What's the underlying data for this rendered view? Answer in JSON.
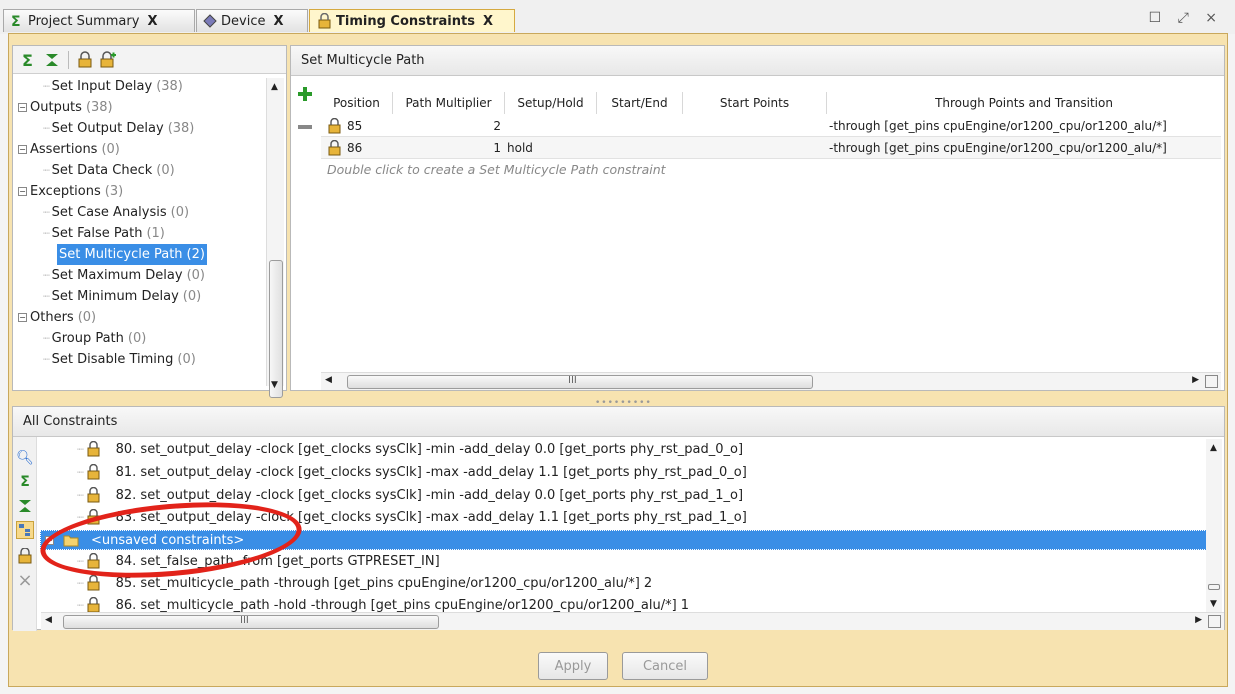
{
  "tabs": [
    {
      "label": "Project Summary",
      "icon": "sigma-icon",
      "close": "X"
    },
    {
      "label": "Device",
      "icon": "device-chip-icon",
      "close": "X"
    },
    {
      "label": "Timing Constraints",
      "icon": "timing-lock-icon",
      "close": "X"
    }
  ],
  "window_controls": "☐ ⤢ ×",
  "tree": {
    "items": [
      {
        "label": "Set Input Delay",
        "count": "(38)"
      },
      {
        "label": "Outputs",
        "count": "(38)"
      },
      {
        "label": "Set Output Delay",
        "count": "(38)"
      },
      {
        "label": "Assertions",
        "count": "(0)"
      },
      {
        "label": "Set Data Check",
        "count": "(0)"
      },
      {
        "label": "Exceptions",
        "count": "(3)"
      },
      {
        "label": "Set Case Analysis",
        "count": "(0)"
      },
      {
        "label": "Set False Path",
        "count": "(1)"
      },
      {
        "label": "Set Multicycle Path",
        "count": "(2)"
      },
      {
        "label": "Set Maximum Delay",
        "count": "(0)"
      },
      {
        "label": "Set Minimum Delay",
        "count": "(0)"
      },
      {
        "label": "Others",
        "count": "(0)"
      },
      {
        "label": "Group Path",
        "count": "(0)"
      },
      {
        "label": "Set Disable Timing",
        "count": "(0)"
      }
    ]
  },
  "multicycle": {
    "title": "Set Multicycle Path",
    "columns": [
      "Position",
      "Path Multiplier",
      "Setup/Hold",
      "Start/End",
      "Start Points",
      "Through Points and Transition"
    ],
    "rows": [
      {
        "position": "85",
        "multiplier": "2",
        "setup_hold": "",
        "start_end": "",
        "start_points": "",
        "through": "-through [get_pins cpuEngine/or1200_cpu/or1200_alu/*]"
      },
      {
        "position": "86",
        "multiplier": "1",
        "setup_hold": "hold",
        "start_end": "",
        "start_points": "",
        "through": "-through [get_pins cpuEngine/or1200_cpu/or1200_alu/*]"
      }
    ],
    "hint": "Double click to create a Set Multicycle Path constraint",
    "scroll_mark": "III"
  },
  "all_constraints": {
    "title": "All Constraints",
    "lines": [
      "80. set_output_delay -clock [get_clocks sysClk] -min -add_delay 0.0 [get_ports phy_rst_pad_0_o]",
      "81. set_output_delay -clock [get_clocks sysClk] -max -add_delay 1.1 [get_ports phy_rst_pad_0_o]",
      "82. set_output_delay -clock [get_clocks sysClk] -min -add_delay 0.0 [get_ports phy_rst_pad_1_o]",
      "83. set_output_delay -clock [get_clocks sysClk] -max -add_delay 1.1 [get_ports phy_rst_pad_1_o]"
    ],
    "unsaved_label": "<unsaved constraints>",
    "unsaved_lines": [
      "84. set_false_path -from [get_ports GTPRESET_IN]",
      "85. set_multicycle_path -through [get_pins cpuEngine/or1200_cpu/or1200_alu/*] 2",
      "86. set_multicycle_path -hold -through [get_pins cpuEngine/or1200_cpu/or1200_alu/*] 1"
    ],
    "scroll_mark": "III"
  },
  "buttons": {
    "apply": "Apply",
    "cancel": "Cancel"
  },
  "colors": {
    "selection": "#3a8ee6",
    "frame": "#f7e3b0",
    "annotation": "#e2231a"
  }
}
